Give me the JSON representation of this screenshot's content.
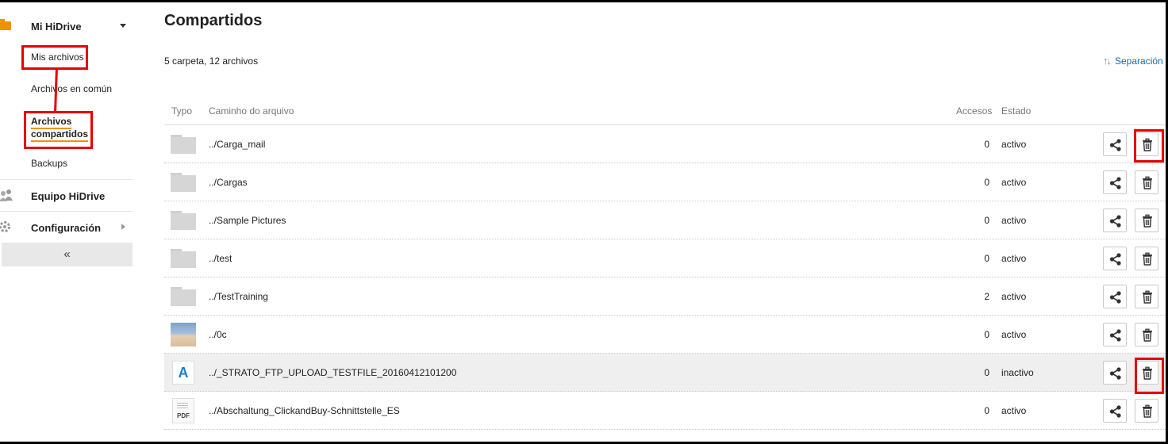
{
  "sidebar": {
    "my_hidrive": "Mi HiDrive",
    "my_files": "Mis archivos",
    "common_files": "Archivos en común",
    "shared_files_line1": "Archivos",
    "shared_files_line2": "compartidos",
    "backups": "Backups",
    "team": "Equipo HiDrive",
    "settings": "Configuración",
    "collapse": "«"
  },
  "main": {
    "title": "Compartidos",
    "summary": "5 carpeta, 12 archivos",
    "sort_label": "Separación"
  },
  "table": {
    "headers": {
      "type": "Typo",
      "path": "Caminho do arquivo",
      "accesses": "Accesos",
      "status": "Estado"
    },
    "rows": [
      {
        "type": "folder",
        "path": "../Carga_mail",
        "accesses": "0",
        "status": "activo"
      },
      {
        "type": "folder",
        "path": "../Cargas",
        "accesses": "0",
        "status": "activo"
      },
      {
        "type": "folder",
        "path": "../Sample Pictures",
        "accesses": "0",
        "status": "activo"
      },
      {
        "type": "folder",
        "path": "../test",
        "accesses": "0",
        "status": "activo"
      },
      {
        "type": "folder",
        "path": "../TestTraining",
        "accesses": "2",
        "status": "activo"
      },
      {
        "type": "image",
        "path": "../0c",
        "accesses": "0",
        "status": "activo"
      },
      {
        "type": "text",
        "type_glyph": "A",
        "path": "../_STRATO_FTP_UPLOAD_TESTFILE_20160412101200",
        "accesses": "0",
        "status": "inactivo"
      },
      {
        "type": "pdf",
        "type_glyph": "PDF",
        "path": "../Abschaltung_ClickandBuy-Schnittstelle_ES",
        "accesses": "0",
        "status": "activo"
      }
    ]
  },
  "icons": {
    "row_actions": [
      "share-icon",
      "trash-icon"
    ],
    "nav": [
      "folder-icon",
      "team-icon",
      "gear-icon"
    ]
  },
  "colors": {
    "accent": "#f29100",
    "link": "#0a6fb8",
    "annotation": "#e60000"
  }
}
